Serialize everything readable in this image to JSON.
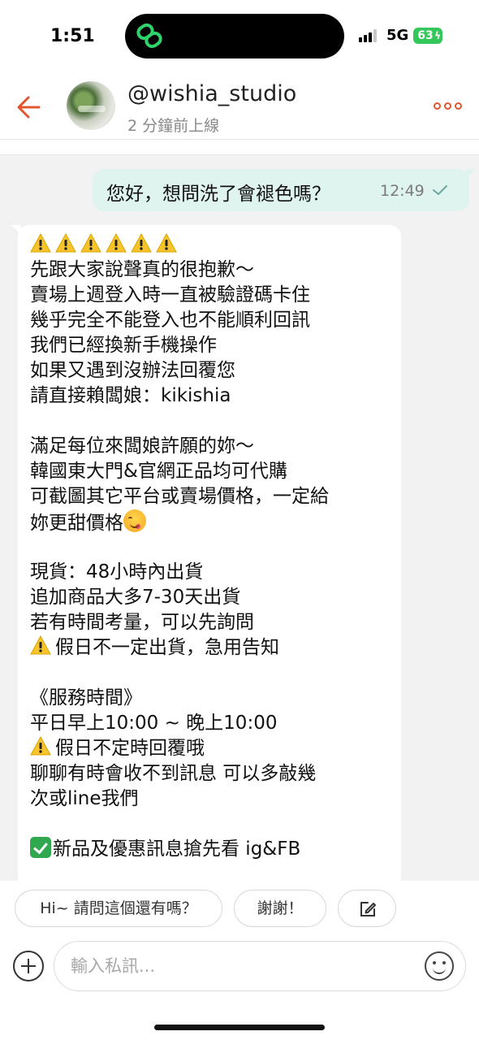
{
  "status_bar": {
    "time": "1:51",
    "network": "5G",
    "battery": "63",
    "icons": [
      "app-link-icon",
      "signal-icon",
      "battery-charging-icon"
    ]
  },
  "header": {
    "handle": "@wishia_studio",
    "presence": "2 分鐘前上線",
    "icons": [
      "back-arrow-icon",
      "more-options-icon"
    ],
    "accent_color": "#e0562e"
  },
  "chat": {
    "sent_message": {
      "text": "您好，想問洗了會褪色嗎？",
      "time": "12:49",
      "status_icon": "delivered-check-icon",
      "bubble_color": "#dff3ef"
    },
    "received_message": {
      "lines": [
        "",
        "先跟大家說聲真的很抱歉～",
        "賣場上週登入時一直被驗證碼卡住",
        "幾乎完全不能登入也不能順利回訊",
        "我們已經換新手機操作",
        "如果又遇到沒辦法回覆您",
        "請直接賴闆娘：kikishia",
        "",
        "滿足每位來闆娘許願的妳～",
        "韓國東大門&官網正品均可代購",
        "可截圖其它平台或賣場價格，一定給",
        "妳更甜價格",
        "",
        "現貨：48小時內出貨",
        "追加商品大多7-30天出貨",
        "若有時間考量，可以先詢問",
        "假日不一定出貨，急用告知",
        "",
        "《服務時間》",
        "平日早上10:00 ~ 晚上10:00",
        "假日不定時回覆哦",
        "聊聊有時會收不到訊息 可以多敲幾",
        "次或line我們",
        "",
        "新品及優惠訊息搶先看 ig&FB"
      ],
      "emoji_icons": [
        "warning-icon",
        "yum-face-icon",
        "check-mark-button-icon"
      ]
    }
  },
  "quick_replies": [
    "Hi~ 請問這個還有嗎？",
    "謝謝！"
  ],
  "composer": {
    "placeholder": "輸入私訊...",
    "icons": [
      "add-icon",
      "emoji-icon",
      "edit-icon"
    ]
  }
}
